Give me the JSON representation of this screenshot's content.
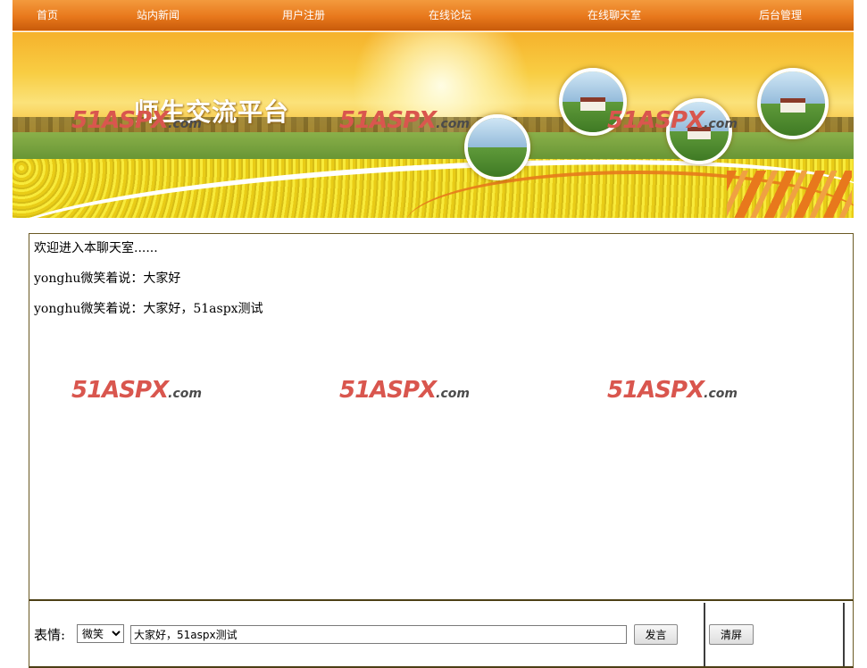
{
  "nav": {
    "items": [
      "首页",
      "站内新闻",
      "用户注册",
      "在线论坛",
      "在线聊天室",
      "后台管理"
    ],
    "bg_color": "#e8781c"
  },
  "banner": {
    "title": "师生交流平台"
  },
  "watermark": {
    "main": "51ASPX",
    "suffix": ".com"
  },
  "chat": {
    "messages": [
      "欢迎进入本聊天室......",
      "yonghu微笑着说：大家好",
      "yonghu微笑着说：大家好，51aspx测试"
    ]
  },
  "controls": {
    "emotion_label": "表情:",
    "emotion_selected": "微笑",
    "message_value": "大家好，51aspx测试",
    "send_label": "发言",
    "clear_label": "清屏"
  }
}
